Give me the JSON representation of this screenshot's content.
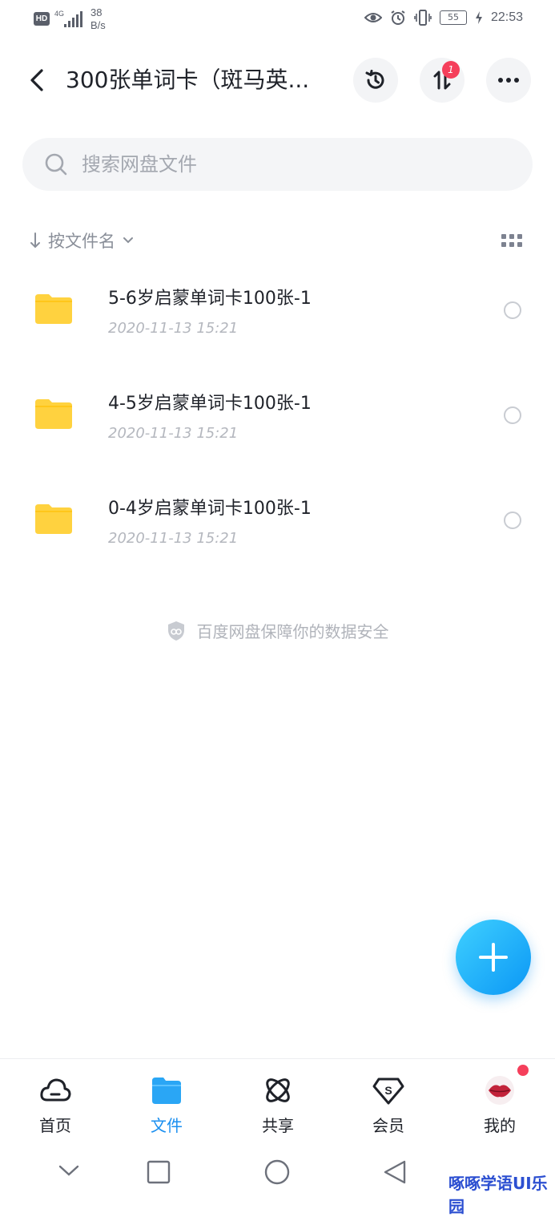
{
  "status_bar": {
    "hd": "HD",
    "network": "4G",
    "speed_value": "38",
    "speed_unit": "B/s",
    "battery": "55",
    "time": "22:53"
  },
  "header": {
    "title": "300张单词卡（斑马英...",
    "transfer_badge": "1"
  },
  "search": {
    "placeholder": "搜索网盘文件"
  },
  "sort": {
    "label": "按文件名"
  },
  "files": [
    {
      "name": "5-6岁启蒙单词卡100张-1",
      "date": "2020-11-13  15:21"
    },
    {
      "name": "4-5岁启蒙单词卡100张-1",
      "date": "2020-11-13  15:21"
    },
    {
      "name": "0-4岁启蒙单词卡100张-1",
      "date": "2020-11-13  15:21"
    }
  ],
  "security_note": "百度网盘保障你的数据安全",
  "nav": {
    "items": [
      {
        "label": "首页",
        "icon": "cloud-icon"
      },
      {
        "label": "文件",
        "icon": "folder-icon"
      },
      {
        "label": "共享",
        "icon": "share-orbit-icon"
      },
      {
        "label": "会员",
        "icon": "vip-shield-icon"
      },
      {
        "label": "我的",
        "icon": "avatar-icon"
      }
    ]
  },
  "watermark": "啄啄学语UI乐园",
  "colors": {
    "accent": "#1a8ff0",
    "folder": "#ffd23f",
    "badge": "#f53f5b"
  }
}
